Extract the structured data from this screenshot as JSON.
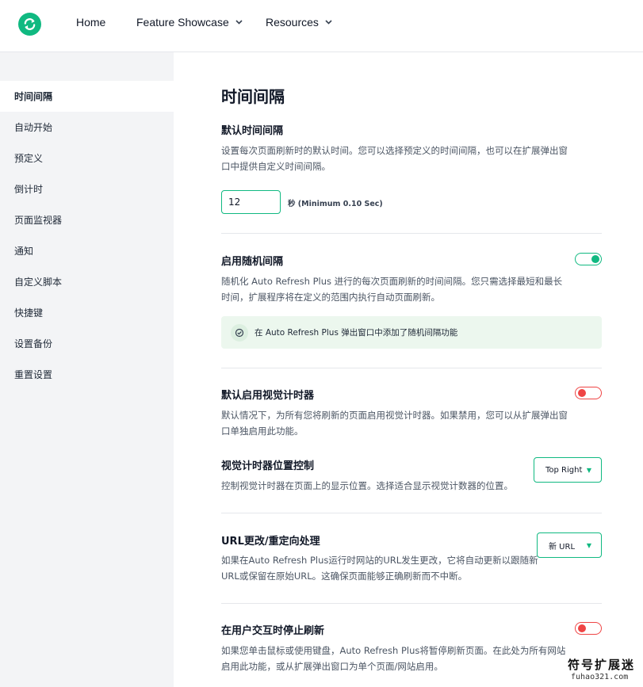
{
  "header": {
    "nav": [
      {
        "label": "Home"
      },
      {
        "label": "Feature Showcase"
      },
      {
        "label": "Resources"
      }
    ]
  },
  "sidebar": {
    "items": [
      {
        "label": "时间间隔",
        "active": true
      },
      {
        "label": "自动开始"
      },
      {
        "label": "预定义"
      },
      {
        "label": "倒计时"
      },
      {
        "label": "页面监视器"
      },
      {
        "label": "通知"
      },
      {
        "label": "自定义脚本"
      },
      {
        "label": "快捷键"
      },
      {
        "label": "设置备份"
      },
      {
        "label": "重置设置"
      }
    ]
  },
  "main": {
    "title": "时间间隔",
    "default_interval": {
      "title": "默认时间间隔",
      "desc": "设置每次页面刷新时的默认时间。您可以选择预定义的时间间隔，也可以在扩展弹出窗口中提供自定义时间间隔。",
      "value": "12",
      "unit": "秒 (Minimum 0.10 Sec)"
    },
    "random_interval": {
      "title": "启用随机间隔",
      "desc": "随机化 Auto Refresh Plus 进行的每次页面刷新的时间间隔。您只需选择最短和最长时间，扩展程序将在定义的范围内执行自动页面刷新。",
      "enabled": true,
      "notice": "在 Auto Refresh Plus 弹出窗口中添加了随机间隔功能"
    },
    "visual_timer": {
      "title": "默认启用视觉计时器",
      "desc": "默认情况下，为所有您将刷新的页面启用视觉计时器。如果禁用，您可以从扩展弹出窗口单独启用此功能。",
      "enabled": false
    },
    "timer_position": {
      "title": "视觉计时器位置控制",
      "desc": "控制视觉计时器在页面上的显示位置。选择适合显示视觉计数器的位置。",
      "selected": "Top Right"
    },
    "url_change": {
      "title": "URL更改/重定向处理",
      "desc": "如果在Auto Refresh Plus运行时网站的URL发生更改，它将自动更新以跟随新URL或保留在原始URL。这确保页面能够正确刷新而不中断。",
      "selected": "新 URL"
    },
    "stop_on_interaction": {
      "title": "在用户交互时停止刷新",
      "desc": "如果您单击鼠标或使用键盘，Auto Refresh Plus将暂停刷新页面。在此处为所有网站启用此功能，或从扩展弹出窗口为单个页面/网站启用。",
      "enabled": false
    }
  },
  "watermark": {
    "line1": "符号扩展迷",
    "line2": "fuhao321.com"
  },
  "colors": {
    "accent": "#10b981",
    "off": "#ef4444",
    "sidebar_bg": "#f3f4f6",
    "notice_bg": "#ecf7ee"
  }
}
